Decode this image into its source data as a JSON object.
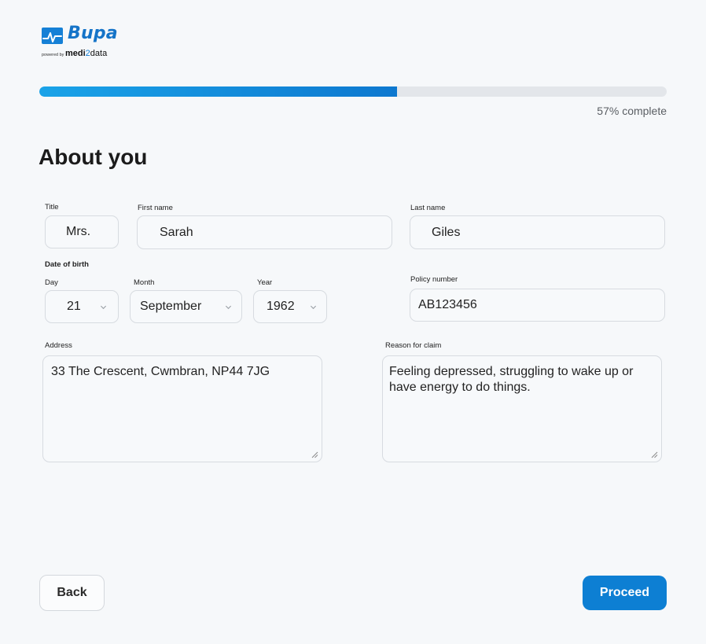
{
  "brand": {
    "name": "Bupa",
    "powered_by": "powered by",
    "partner_a": "medi",
    "partner_b": "2",
    "partner_c": "data",
    "color": "#1574c8"
  },
  "progress": {
    "percent": 57,
    "label": "57% complete"
  },
  "heading": "About you",
  "form": {
    "title": {
      "label": "Title",
      "value": "Mrs."
    },
    "first_name": {
      "label": "First name",
      "value": "Sarah"
    },
    "last_name": {
      "label": "Last name",
      "value": "Giles"
    },
    "dob": {
      "label": "Date of birth",
      "day": {
        "label": "Day",
        "value": "21"
      },
      "month": {
        "label": "Month",
        "value": "September"
      },
      "year": {
        "label": "Year",
        "value": "1962"
      }
    },
    "policy_number": {
      "label": "Policy number",
      "value": "AB123456"
    },
    "address": {
      "label": "Address",
      "value": "33 The Crescent, Cwmbran, NP44 7JG"
    },
    "reason": {
      "label": "Reason for claim",
      "value": "Feeling depressed, struggling to wake up or have energy to do things."
    }
  },
  "buttons": {
    "back": "Back",
    "proceed": "Proceed",
    "proceed_color": "#0d7fd3"
  }
}
